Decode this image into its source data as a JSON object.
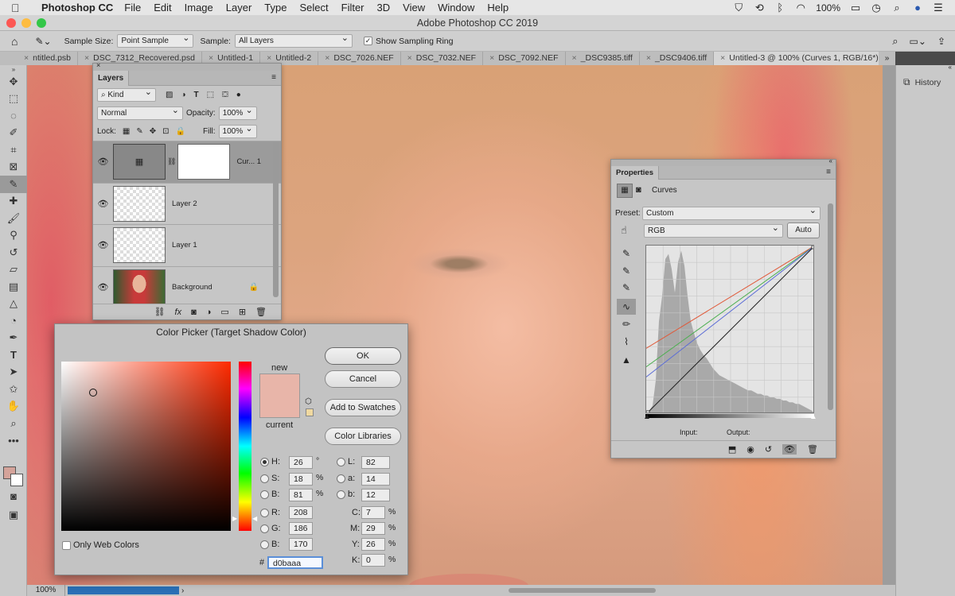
{
  "menubar": {
    "app_name": "Photoshop CC",
    "items": [
      "File",
      "Edit",
      "Image",
      "Layer",
      "Type",
      "Select",
      "Filter",
      "3D",
      "View",
      "Window",
      "Help"
    ],
    "battery": "100%"
  },
  "window": {
    "title": "Adobe Photoshop CC 2019"
  },
  "options": {
    "sample_size_label": "Sample Size:",
    "sample_size_value": "Point Sample",
    "sample_label": "Sample:",
    "sample_value": "All Layers",
    "show_ring_label": "Show Sampling Ring"
  },
  "tabs": [
    {
      "label": "ntitled.psb"
    },
    {
      "label": "DSC_7312_Recovered.psd"
    },
    {
      "label": "Untitled-1"
    },
    {
      "label": "Untitled-2"
    },
    {
      "label": "DSC_7026.NEF"
    },
    {
      "label": "DSC_7032.NEF"
    },
    {
      "label": "DSC_7092.NEF"
    },
    {
      "label": "_DSC9385.tiff"
    },
    {
      "label": "_DSC9406.tiff"
    },
    {
      "label": "Untitled-3 @ 100% (Curves 1, RGB/16*) *"
    }
  ],
  "dock": {
    "history_label": "History"
  },
  "status": {
    "zoom": "100%"
  },
  "layers": {
    "title": "Layers",
    "kind": "Kind",
    "blend_mode": "Normal",
    "opacity_label": "Opacity:",
    "opacity": "100%",
    "lock_label": "Lock:",
    "fill_label": "Fill:",
    "fill": "100%",
    "items": [
      {
        "name": "Cur... 1"
      },
      {
        "name": "Layer 2"
      },
      {
        "name": "Layer 1"
      },
      {
        "name": "Background"
      }
    ]
  },
  "color_picker": {
    "title": "Color Picker (Target Shadow Color)",
    "new_label": "new",
    "current_label": "current",
    "new_color": "#e8b5a9",
    "buttons": {
      "ok": "OK",
      "cancel": "Cancel",
      "add": "Add to Swatches",
      "libraries": "Color Libraries"
    },
    "only_web": "Only Web Colors",
    "hsb": {
      "h": "26",
      "s": "18",
      "b": "81"
    },
    "rgb": {
      "r": "208",
      "g": "186",
      "b": "170"
    },
    "lab": {
      "l": "82",
      "a": "14",
      "b": "12"
    },
    "cmyk": {
      "c": "7",
      "m": "29",
      "y": "26",
      "k": "0"
    },
    "hex": "d0baaa",
    "labels": {
      "H": "H:",
      "S": "S:",
      "B": "B:",
      "R": "R:",
      "G": "G:",
      "Bb": "B:",
      "L": "L:",
      "a": "a:",
      "b": "b:",
      "C": "C:",
      "M": "M:",
      "Y": "Y:",
      "K": "K:",
      "hash": "#"
    },
    "units": {
      "deg": "°",
      "pct": "%"
    }
  },
  "properties": {
    "title": "Properties",
    "adjustment": "Curves",
    "preset_label": "Preset:",
    "preset_value": "Custom",
    "channel": "RGB",
    "auto_label": "Auto",
    "input_label": "Input:",
    "output_label": "Output:",
    "curve_colors": {
      "red": "#e05a3a",
      "green": "#4caf50",
      "blue": "#5b6cd6",
      "rgb": "#222222"
    }
  }
}
